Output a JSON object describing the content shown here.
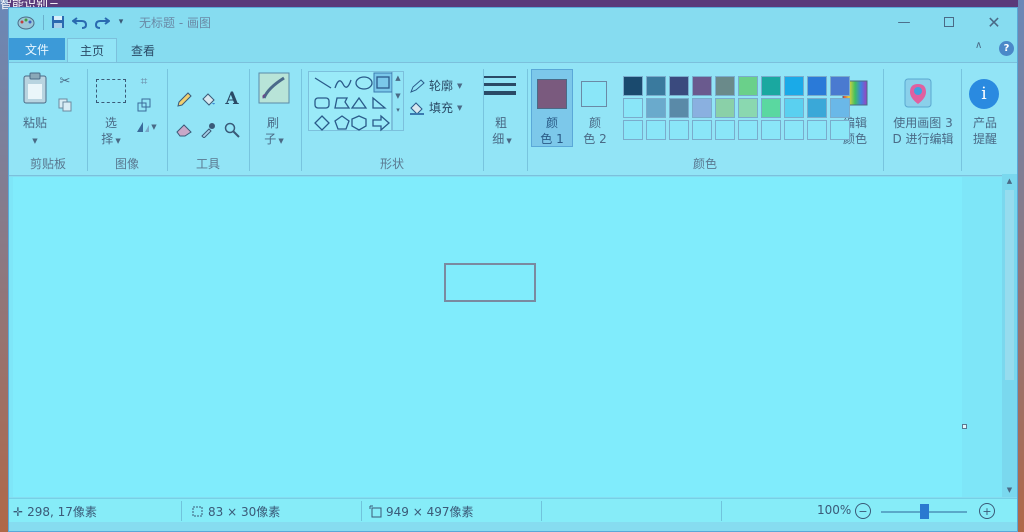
{
  "desktop": {
    "corner_text": "智能识别三"
  },
  "window": {
    "title": "无标题 - 画图"
  },
  "quick_access": {
    "save_icon": "save-icon",
    "undo_icon": "undo-icon",
    "redo_icon": "redo-icon",
    "customize_icon": "customize-quick-access-icon"
  },
  "tabs": {
    "file": "文件",
    "home": "主页",
    "view": "查看"
  },
  "clipboard": {
    "paste": "粘贴",
    "group": "剪贴板"
  },
  "image": {
    "select_1": "选",
    "select_2": "择",
    "group": "图像"
  },
  "tools": {
    "text_glyph": "A",
    "group": "工具"
  },
  "brushes": {
    "label_1": "刷",
    "label_2": "子"
  },
  "shapes": {
    "outline": "轮廓",
    "fill": "填充",
    "group": "形状"
  },
  "size": {
    "label_1": "粗",
    "label_2": "细"
  },
  "colors": {
    "color1_1": "颜",
    "color1_2": "色 1",
    "color2_1": "颜",
    "color2_2": "色 2",
    "edit_1": "编辑",
    "edit_2": "颜色",
    "group": "颜色",
    "color1_value": "#7a5a7e",
    "color2_value": "#8ae6f8",
    "palette_row1": [
      "#1a4a6e",
      "#3a7a9e",
      "#3a4a7e",
      "#6a5a8e",
      "#6a8a8a",
      "#6ad08a",
      "#1aa8a0",
      "#1aaae8",
      "#2a7ad8",
      "#4a7ad0"
    ],
    "palette_row2": [
      "#8ae6f8",
      "#6aaacc",
      "#5a8aa8",
      "#8ab0e0",
      "#8ad0a8",
      "#8ad8b0",
      "#5ad8a0",
      "#5ad0f0",
      "#3aa8d8",
      "#6ab8e8"
    ],
    "palette_row3": [
      "#8ae6f8",
      "#8ae6f8",
      "#8ae6f8",
      "#8ae6f8",
      "#8ae6f8",
      "#8ae6f8",
      "#8ae6f8",
      "#8ae6f8",
      "#8ae6f8",
      "#8ae6f8"
    ]
  },
  "paint3d": {
    "label_1": "使用画图 3",
    "label_2": "D 进行编辑"
  },
  "product_alert": {
    "label_1": "产品",
    "label_2": "提醒"
  },
  "status": {
    "cursor_pos": "298, 17像素",
    "selection_size": "83 × 30像素",
    "image_size": "949 × 497像素",
    "zoom": "100%"
  }
}
